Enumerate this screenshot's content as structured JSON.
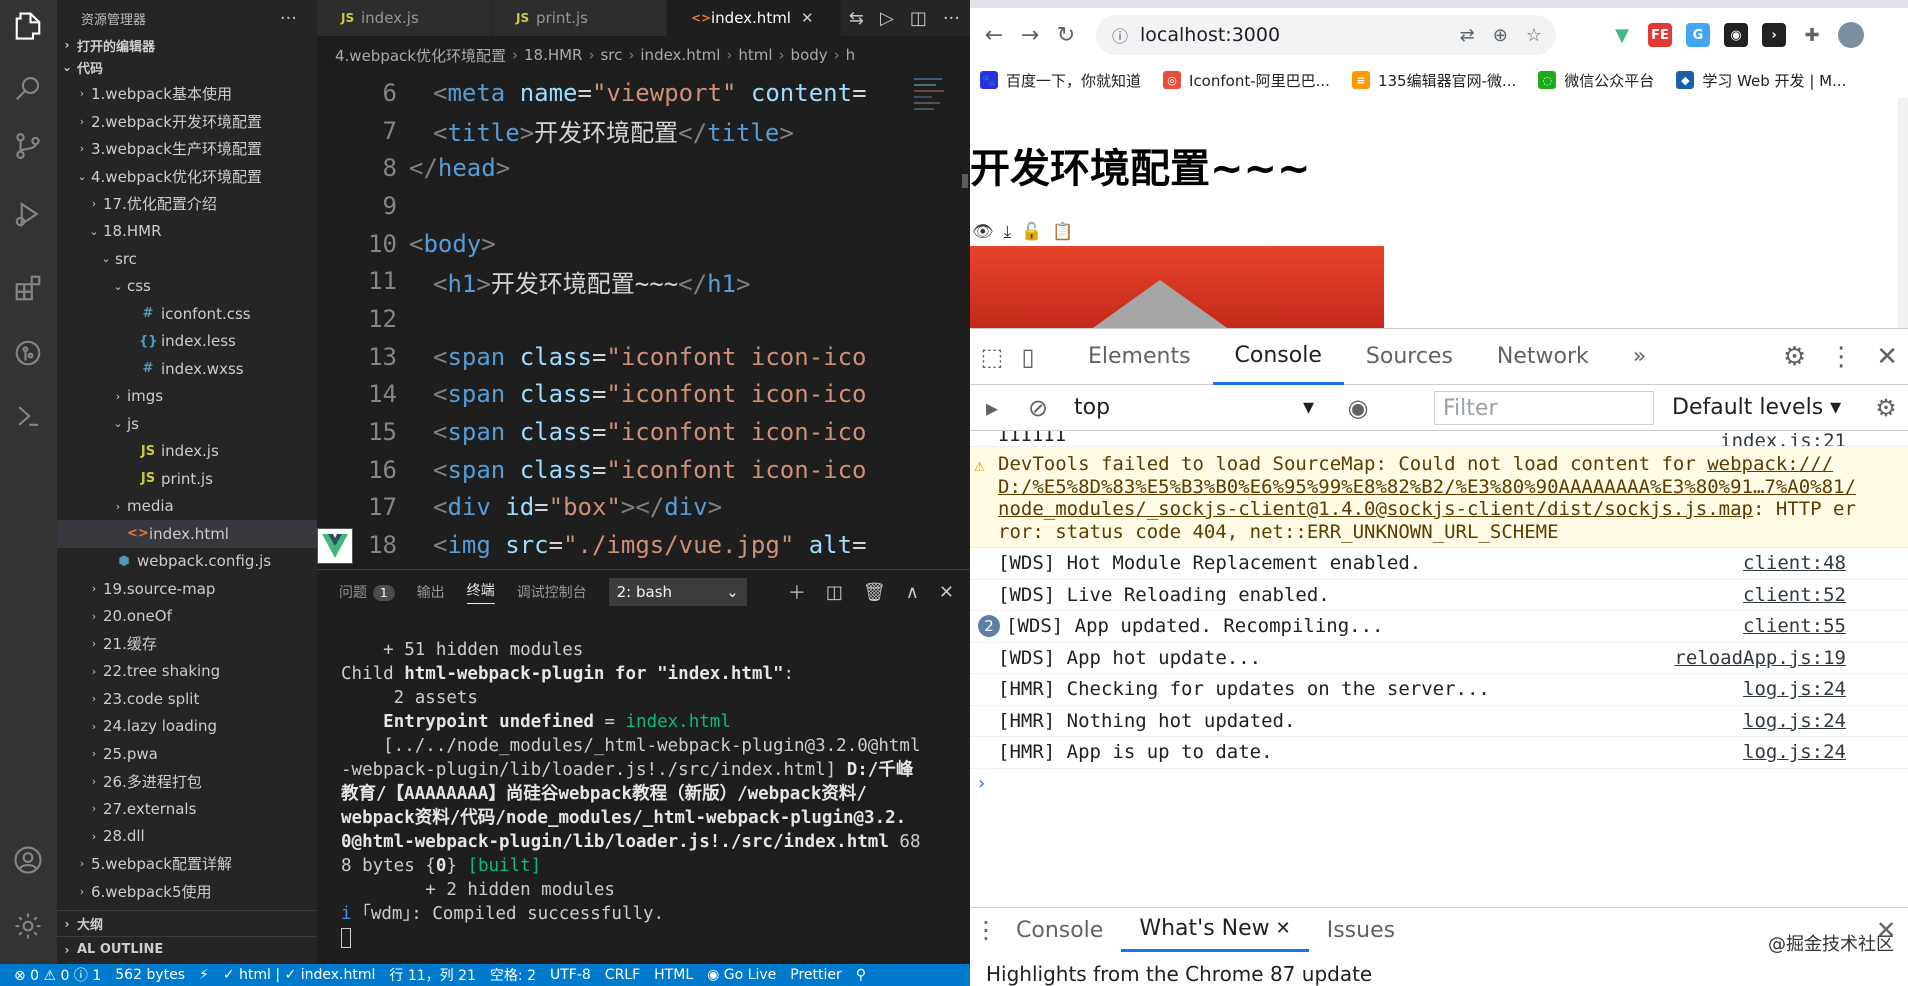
{
  "vscode": {
    "explorer_title": "资源管理器",
    "open_editors": "打开的编辑器",
    "folder": "代码",
    "tree": [
      {
        "label": "1.webpack基本使用",
        "depth": 1,
        "type": "folder",
        "open": false
      },
      {
        "label": "2.webpack开发环境配置",
        "depth": 1,
        "type": "folder",
        "open": false
      },
      {
        "label": "3.webpack生产环境配置",
        "depth": 1,
        "type": "folder",
        "open": false
      },
      {
        "label": "4.webpack优化环境配置",
        "depth": 1,
        "type": "folder",
        "open": true
      },
      {
        "label": "17.优化配置介绍",
        "depth": 2,
        "type": "folder",
        "open": false
      },
      {
        "label": "18.HMR",
        "depth": 2,
        "type": "folder",
        "open": true
      },
      {
        "label": "src",
        "depth": 3,
        "type": "folder",
        "open": true
      },
      {
        "label": "css",
        "depth": 4,
        "type": "folder",
        "open": true
      },
      {
        "label": "iconfont.css",
        "depth": 5,
        "type": "css"
      },
      {
        "label": "index.less",
        "depth": 5,
        "type": "less"
      },
      {
        "label": "index.wxss",
        "depth": 5,
        "type": "css"
      },
      {
        "label": "imgs",
        "depth": 4,
        "type": "folder",
        "open": false
      },
      {
        "label": "js",
        "depth": 4,
        "type": "folder",
        "open": true
      },
      {
        "label": "index.js",
        "depth": 5,
        "type": "js"
      },
      {
        "label": "print.js",
        "depth": 5,
        "type": "js"
      },
      {
        "label": "media",
        "depth": 4,
        "type": "folder",
        "open": false
      },
      {
        "label": "index.html",
        "depth": 4,
        "type": "html",
        "selected": true
      },
      {
        "label": "webpack.config.js",
        "depth": 3,
        "type": "webpack"
      },
      {
        "label": "19.source-map",
        "depth": 2,
        "type": "folder",
        "open": false
      },
      {
        "label": "20.oneOf",
        "depth": 2,
        "type": "folder",
        "open": false
      },
      {
        "label": "21.缓存",
        "depth": 2,
        "type": "folder",
        "open": false
      },
      {
        "label": "22.tree shaking",
        "depth": 2,
        "type": "folder",
        "open": false
      },
      {
        "label": "23.code split",
        "depth": 2,
        "type": "folder",
        "open": false
      },
      {
        "label": "24.lazy loading",
        "depth": 2,
        "type": "folder",
        "open": false
      },
      {
        "label": "25.pwa",
        "depth": 2,
        "type": "folder",
        "open": false
      },
      {
        "label": "26.多进程打包",
        "depth": 2,
        "type": "folder",
        "open": false
      },
      {
        "label": "27.externals",
        "depth": 2,
        "type": "folder",
        "open": false
      },
      {
        "label": "28.dll",
        "depth": 2,
        "type": "folder",
        "open": false
      },
      {
        "label": "5.webpack配置详解",
        "depth": 1,
        "type": "folder",
        "open": false
      },
      {
        "label": "6.webpack5使用",
        "depth": 1,
        "type": "folder",
        "open": false
      }
    ],
    "outline_section": "大纲",
    "al_outline": "AL OUTLINE",
    "tabs": [
      {
        "label": "index.js",
        "icon": "JS",
        "active": false
      },
      {
        "label": "print.js",
        "icon": "JS",
        "active": false
      },
      {
        "label": "index.html",
        "icon": "<>",
        "active": true
      }
    ],
    "breadcrumb": [
      "4.webpack优化环境配置",
      "18.HMR",
      "src",
      "index.html",
      "html",
      "body",
      "h"
    ],
    "code_lines": [
      {
        "n": "6",
        "html": "<span class='t-br'>&lt;</span><span class='t-tag'>meta</span> <span class='t-attr'>name</span>=<span class='t-str'>\"viewport\"</span> <span class='t-attr'>content</span>="
      },
      {
        "n": "7",
        "html": "<span class='t-br'>&lt;</span><span class='t-tag'>title</span><span class='t-br'>&gt;</span>开发环境配置<span class='t-br'>&lt;/</span><span class='t-tag'>title</span><span class='t-br'>&gt;</span>"
      },
      {
        "n": "8",
        "html": "<span class='t-br'>&lt;/</span><span class='t-tag'>head</span><span class='t-br'>&gt;</span>",
        "outdent": true
      },
      {
        "n": "9",
        "html": ""
      },
      {
        "n": "10",
        "html": "<span class='t-br'>&lt;</span><span class='t-tag'>body</span><span class='t-br'>&gt;</span>",
        "outdent": true
      },
      {
        "n": "11",
        "html": "<span class='t-br'>&lt;</span><span class='t-tag'>h1</span><span class='t-br'>&gt;</span>开发环境配置~~~<span class='t-br'>&lt;/</span><span class='t-tag'>h1</span><span class='t-br'>&gt;</span>"
      },
      {
        "n": "12",
        "html": ""
      },
      {
        "n": "13",
        "html": "<span class='t-br'>&lt;</span><span class='t-tag'>span</span> <span class='t-attr'>class</span>=<span class='t-str'>\"iconfont icon-ico</span>"
      },
      {
        "n": "14",
        "html": "<span class='t-br'>&lt;</span><span class='t-tag'>span</span> <span class='t-attr'>class</span>=<span class='t-str'>\"iconfont icon-ico</span>"
      },
      {
        "n": "15",
        "html": "<span class='t-br'>&lt;</span><span class='t-tag'>span</span> <span class='t-attr'>class</span>=<span class='t-str'>\"iconfont icon-ico</span>"
      },
      {
        "n": "16",
        "html": "<span class='t-br'>&lt;</span><span class='t-tag'>span</span> <span class='t-attr'>class</span>=<span class='t-str'>\"iconfont icon-ico</span>"
      },
      {
        "n": "17",
        "html": "<span class='t-br'>&lt;</span><span class='t-tag'>div</span> <span class='t-attr'>id</span>=<span class='t-str'>\"box\"</span><span class='t-br'>&gt;&lt;/</span><span class='t-tag'>div</span><span class='t-br'>&gt;</span>"
      },
      {
        "n": "18",
        "html": "<span class='t-br'>&lt;</span><span class='t-tag'>img</span> <span class='t-attr'>src</span>=<span class='t-str'>\"./imgs/vue.jpg\"</span> <span class='t-attr'>alt</span>="
      }
    ],
    "vue_badge": "Vue.js",
    "panel": {
      "tabs": [
        "问题",
        "输出",
        "终端",
        "调试控制台"
      ],
      "problems_count": "1",
      "terminal_select": "2: bash"
    },
    "terminal_lines": [
      "    + 51 hidden modules",
      "Child <b>html-webpack-plugin for \"index.html\"</b>:",
      "     2 assets",
      "    <b>Entrypoint</b> <b>undefined</b> = <span class='g'>index.html</span>",
      "    [../../node_modules/_html-webpack-plugin@3.2.0@html",
      "-webpack-plugin/lib/loader.js!./src/index.html] <b>D:/千峰</b>",
      "<b>教育/【AAAAAAAA】尚硅谷webpack教程（新版）/webpack资料/</b>",
      "<b>webpack资料/代码/node_modules/_html-webpack-plugin@3.2.</b>",
      "<b>0@html-webpack-plugin/lib/loader.js!./src/index.html</b> 68",
      "8 bytes {<b>0</b>} <span class='g'>[built]</span>",
      "        + 2 hidden modules",
      "<span style='color:#3b8eea'>i</span> ｢wdm｣: Compiled successfully."
    ],
    "status": [
      "⊗ 0 ⚠ 0 ⓘ 1",
      "562 bytes",
      "⚡",
      "✓ html | ✓ index.html",
      "行 11，列 21",
      "空格: 2",
      "UTF-8",
      "CRLF",
      "HTML",
      "◉ Go Live",
      "Prettier",
      "⚲"
    ]
  },
  "chrome": {
    "url": "localhost:3000",
    "bookmarks": [
      {
        "label": "百度一下，你就知道",
        "color": "#2932e1",
        "glyph": "🐾"
      },
      {
        "label": "Iconfont-阿里巴巴...",
        "color": "#e94e3c",
        "glyph": "◎"
      },
      {
        "label": "135编辑器官网-微...",
        "color": "#ff9900",
        "glyph": "≡"
      },
      {
        "label": "微信公众平台",
        "color": "#1aad19",
        "glyph": "◌"
      },
      {
        "label": "学习 Web 开发 | M...",
        "color": "#1b5fa8",
        "glyph": "◆"
      }
    ],
    "page_heading": "开发环境配置~~~",
    "page_icons": [
      "👁",
      "⤓",
      "🔓",
      "📋"
    ],
    "devtools": {
      "tabs": [
        "Elements",
        "Console",
        "Sources",
        "Network"
      ],
      "context": "top",
      "filter_placeholder": "Filter",
      "levels": "Default levels",
      "truncated_prev": "IIIIII",
      "truncated_src": "index.js:21",
      "warning": {
        "text": "DevTools failed to load SourceMap: Could not load content for ",
        "link": "webpack:///D:/%E5%8D%83%E5%B3%B0%E6%95%99%E8%82%B2/%E3%80%90AAAAAAAA%E3%80%91…7%A0%81/node_modules/_sockjs-client@1.4.0@sockjs-client/dist/sockjs.js.map",
        "tail": ": HTTP error: status code 404, net::ERR_UNKNOWN_URL_SCHEME"
      },
      "messages": [
        {
          "text": "[WDS] Hot Module Replacement enabled.",
          "src": "client:48"
        },
        {
          "text": "[WDS] Live Reloading enabled.",
          "src": "client:52"
        },
        {
          "text": "[WDS] App updated. Recompiling...",
          "src": "client:55",
          "count": "2"
        },
        {
          "text": "[WDS] App hot update...",
          "src": "reloadApp.js:19"
        },
        {
          "text": "[HMR] Checking for updates on the server...",
          "src": "log.js:24"
        },
        {
          "text": "[HMR] Nothing hot updated.",
          "src": "log.js:24"
        },
        {
          "text": "[HMR] App is up to date.",
          "src": "log.js:24"
        }
      ],
      "drawer_tabs": [
        "Console",
        "What's New",
        "Issues"
      ],
      "drawer_body": "Highlights from the Chrome 87 update"
    },
    "watermark": "@掘金技术社区"
  }
}
